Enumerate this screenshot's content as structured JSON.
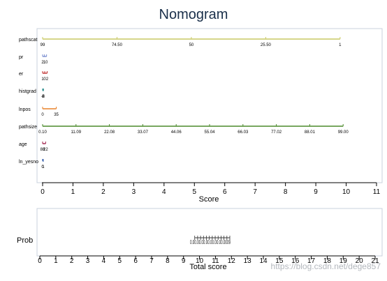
{
  "chart_data": [
    {
      "type": "nomogram",
      "title": "Nomogram",
      "variables": [
        {
          "name": "pathscat",
          "color": "#c8c864",
          "ticks": [
            {
              "label": "99",
              "score": 0
            },
            {
              "label": "74.50",
              "score": 2.45
            },
            {
              "label": "50",
              "score": 4.9
            },
            {
              "label": "25.50",
              "score": 7.35
            },
            {
              "label": "1",
              "score": 9.8
            }
          ]
        },
        {
          "name": "pr",
          "color": "#7b8fd0",
          "ticks": [
            {
              "label": "2",
              "score": 0
            },
            {
              "label": "1",
              "score": 0.06
            },
            {
              "label": "0",
              "score": 0.13
            }
          ]
        },
        {
          "name": "er",
          "color": "#c03030",
          "ticks": [
            {
              "label": "1",
              "score": 0
            },
            {
              "label": "0",
              "score": 0.07
            },
            {
              "label": "2",
              "score": 0.15
            }
          ]
        },
        {
          "name": "histgrad",
          "color": "#2f8f8f",
          "ticks": [
            {
              "label": "4",
              "score": 0
            },
            {
              "label": "2",
              "score": 0.02
            },
            {
              "label": "3",
              "score": 0.03
            }
          ]
        },
        {
          "name": "lnpos",
          "color": "#e8822a",
          "ticks": [
            {
              "label": "0",
              "score": 0
            },
            {
              "label": "35",
              "score": 0.45
            }
          ]
        },
        {
          "name": "pathsize",
          "color": "#4a8a2a",
          "ticks": [
            {
              "label": "0.10",
              "score": 0
            },
            {
              "label": "11.09",
              "score": 1.1
            },
            {
              "label": "22.08",
              "score": 2.2
            },
            {
              "label": "33.07",
              "score": 3.3
            },
            {
              "label": "44.06",
              "score": 4.4
            },
            {
              "label": "55.04",
              "score": 5.5
            },
            {
              "label": "66.03",
              "score": 6.6
            },
            {
              "label": "77.02",
              "score": 7.7
            },
            {
              "label": "88.01",
              "score": 8.8
            },
            {
              "label": "99.00",
              "score": 9.9
            }
          ]
        },
        {
          "name": "age",
          "color": "#a0204a",
          "ticks": [
            {
              "label": "88",
              "score": 0
            },
            {
              "label": "22",
              "score": 0.1
            }
          ]
        },
        {
          "name": "ln_yesno",
          "color": "#2a55a8",
          "ticks": [
            {
              "label": "0",
              "score": 0
            },
            {
              "label": "1",
              "score": 0.02
            }
          ]
        }
      ],
      "score_axis": {
        "xlabel": "Score",
        "xlim": [
          0,
          11
        ],
        "ticks": [
          "0",
          "1",
          "2",
          "3",
          "4",
          "5",
          "6",
          "7",
          "8",
          "9",
          "10",
          "11"
        ]
      }
    },
    {
      "type": "nomogram-probability",
      "row_label": "Prob",
      "prob_scale": {
        "color": "#333333",
        "score_range": [
          9.7,
          11.9
        ],
        "labels_text": "0.00.00.00.00.00.00.00.0009"
      },
      "total_axis": {
        "xlabel": "Total score",
        "xlim": [
          0,
          21
        ],
        "ticks": [
          "0",
          "1",
          "2",
          "3",
          "4",
          "5",
          "6",
          "7",
          "8",
          "9",
          "10",
          "11",
          "12",
          "13",
          "14",
          "15",
          "16",
          "17",
          "18",
          "19",
          "20",
          "21"
        ]
      }
    }
  ],
  "watermark": "https://blog.csdn.net/dege857"
}
